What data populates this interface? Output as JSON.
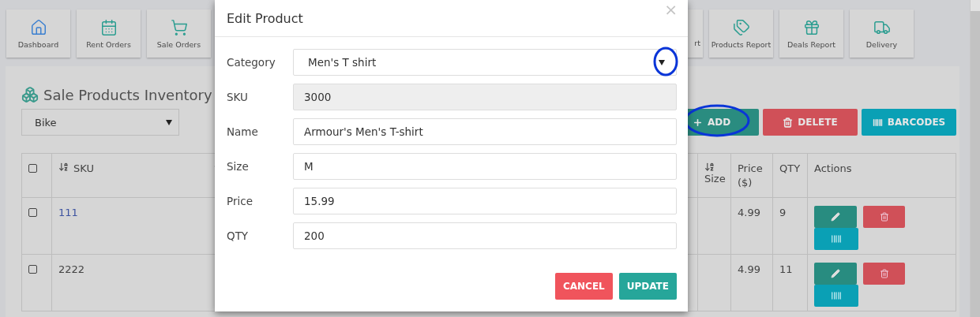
{
  "nav": [
    {
      "label": "Dashboard",
      "color": "#3a7fd0"
    },
    {
      "label": "Rent Orders",
      "color": "#2a9d90"
    },
    {
      "label": "Sale Orders",
      "color": "#2a9d90"
    },
    {
      "label": "rt"
    },
    {
      "label": "Products Report",
      "color": "#2a9d90"
    },
    {
      "label": "Deals Report",
      "color": "#2a9d90"
    },
    {
      "label": "Delivery",
      "color": "#2a9d90"
    }
  ],
  "panel": {
    "title": "Sale Products Inventory",
    "filter": {
      "value": "Bike"
    },
    "buttons": [
      {
        "label": "ADD",
        "kind": "add",
        "highlighted": true
      },
      {
        "label": "DELETE",
        "kind": "delete",
        "highlighted": false
      },
      {
        "label": "BARCODES",
        "kind": "barcodes",
        "highlighted": false
      }
    ]
  },
  "table": {
    "header_checkbox": {
      "checked": false
    },
    "columns": [
      {
        "label": "SKU",
        "sortable": true
      },
      {
        "label": "Size",
        "sortable": true
      },
      {
        "label": "Price ($)",
        "sortable": false
      },
      {
        "label": "QTY",
        "sortable": false
      },
      {
        "label": "Actions",
        "sortable": false
      }
    ],
    "rows": [
      {
        "checked": false,
        "sku": "111",
        "link": true,
        "price": "4.99",
        "qty": "9"
      },
      {
        "checked": false,
        "sku": "2222",
        "link": false,
        "price": "4.99",
        "qty": "11"
      }
    ]
  },
  "modal": {
    "title": "Edit Product",
    "close": "×",
    "fields": [
      {
        "label": "Category",
        "value": "Men's T shirt",
        "kind": "select",
        "disabled": false,
        "highlighted": true
      },
      {
        "label": "SKU",
        "value": "3000",
        "kind": "input",
        "disabled": true,
        "highlighted": false
      },
      {
        "label": "Name",
        "value": "Armour's Men's T-shirt",
        "kind": "input",
        "disabled": false,
        "highlighted": false
      },
      {
        "label": "Size",
        "value": "M",
        "kind": "input",
        "disabled": false,
        "highlighted": false
      },
      {
        "label": "Price",
        "value": "15.99",
        "kind": "input",
        "disabled": false,
        "highlighted": false
      },
      {
        "label": "QTY",
        "value": "200",
        "kind": "input",
        "disabled": false,
        "highlighted": false
      }
    ],
    "buttons": [
      {
        "label": "CANCEL",
        "kind": "cancel"
      },
      {
        "label": "UPDATE",
        "kind": "update"
      }
    ]
  }
}
